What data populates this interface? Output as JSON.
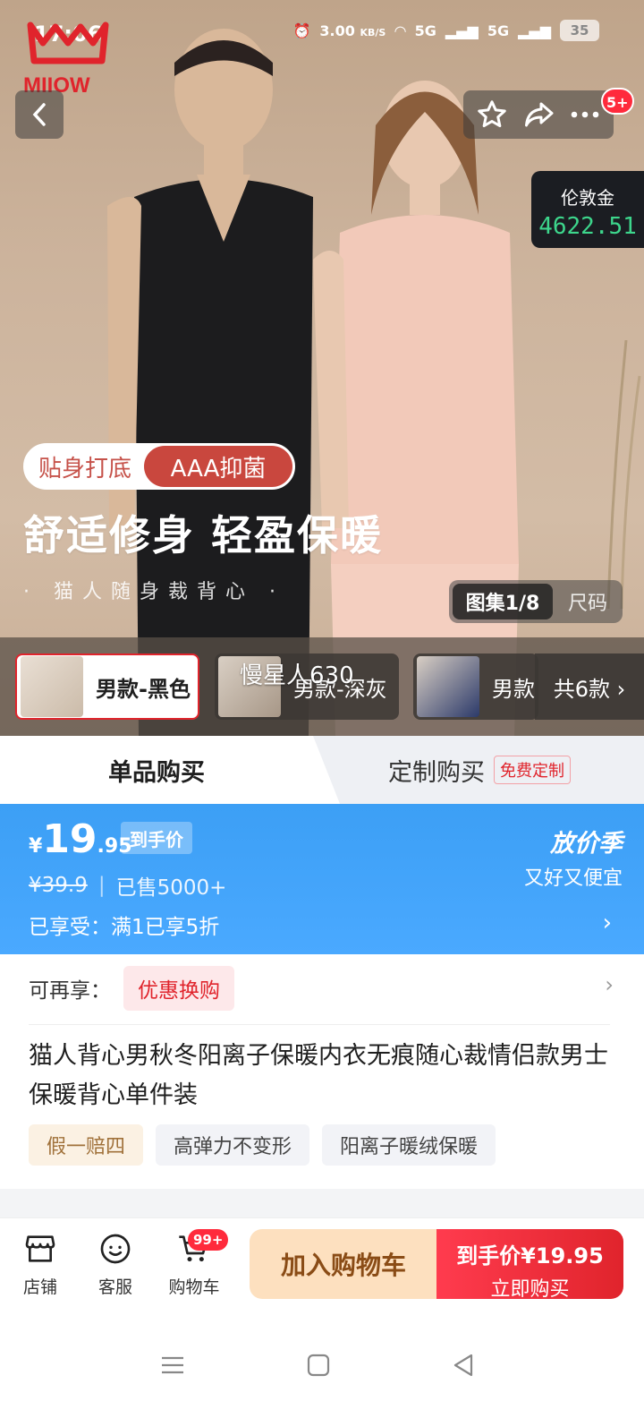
{
  "status_bar": {
    "time": "17:06",
    "speed": "3.00",
    "speed_unit": "KB/S",
    "net1": "5G",
    "net2": "5G",
    "battery": "35"
  },
  "brand": {
    "logo_text": "MIIOW"
  },
  "hero": {
    "badge_count": "5+",
    "gold": {
      "name": "伦敦金",
      "value": "4622.51"
    },
    "tag_left": "贴身打底",
    "tag_right": "AAA抑菌",
    "slogan": "舒适修身 轻盈保暖",
    "sub_slogan": "· 猫人随身裁背心 ·",
    "gallery_tab_active": "图集1/8",
    "gallery_tab_other": "尺码"
  },
  "variants": {
    "items": [
      {
        "label": "男款-黑色",
        "selected": true
      },
      {
        "label": "男款-深灰",
        "selected": false
      },
      {
        "label": "男款",
        "selected": false
      }
    ],
    "overlay_text": "慢星人630",
    "more": "共6款 ›"
  },
  "purchase_modes": {
    "single": "单品购买",
    "custom": "定制购买",
    "custom_tag": "免费定制"
  },
  "price": {
    "currency": "¥",
    "integer": "19",
    "decimal": ".95",
    "tag": "到手价",
    "original": "¥39.9",
    "sold": "已售5000+",
    "season_title": "放价季",
    "season_sub": "又好又便宜",
    "enjoyed": "已享受：满1已享5折"
  },
  "info": {
    "reenjoy_label": "可再享：",
    "coupon": "优惠换购",
    "title": "猫人背心男秋冬阳离子保暖内衣无痕随心裁情侣款男士保暖背心单件装",
    "chips": [
      "假一赔四",
      "高弹力不变形",
      "阳离子暖绒保暖"
    ]
  },
  "bottom_bar": {
    "shop": "店铺",
    "service": "客服",
    "cart": "购物车",
    "cart_badge": "99+",
    "add_to_cart": "加入购物车",
    "buy_price": "到手价¥19.95",
    "buy_now": "立即购买"
  },
  "colors": {
    "brand_red": "#e0242c",
    "price_blue": "#3c9ff5",
    "gold_green": "#3dd68c"
  }
}
